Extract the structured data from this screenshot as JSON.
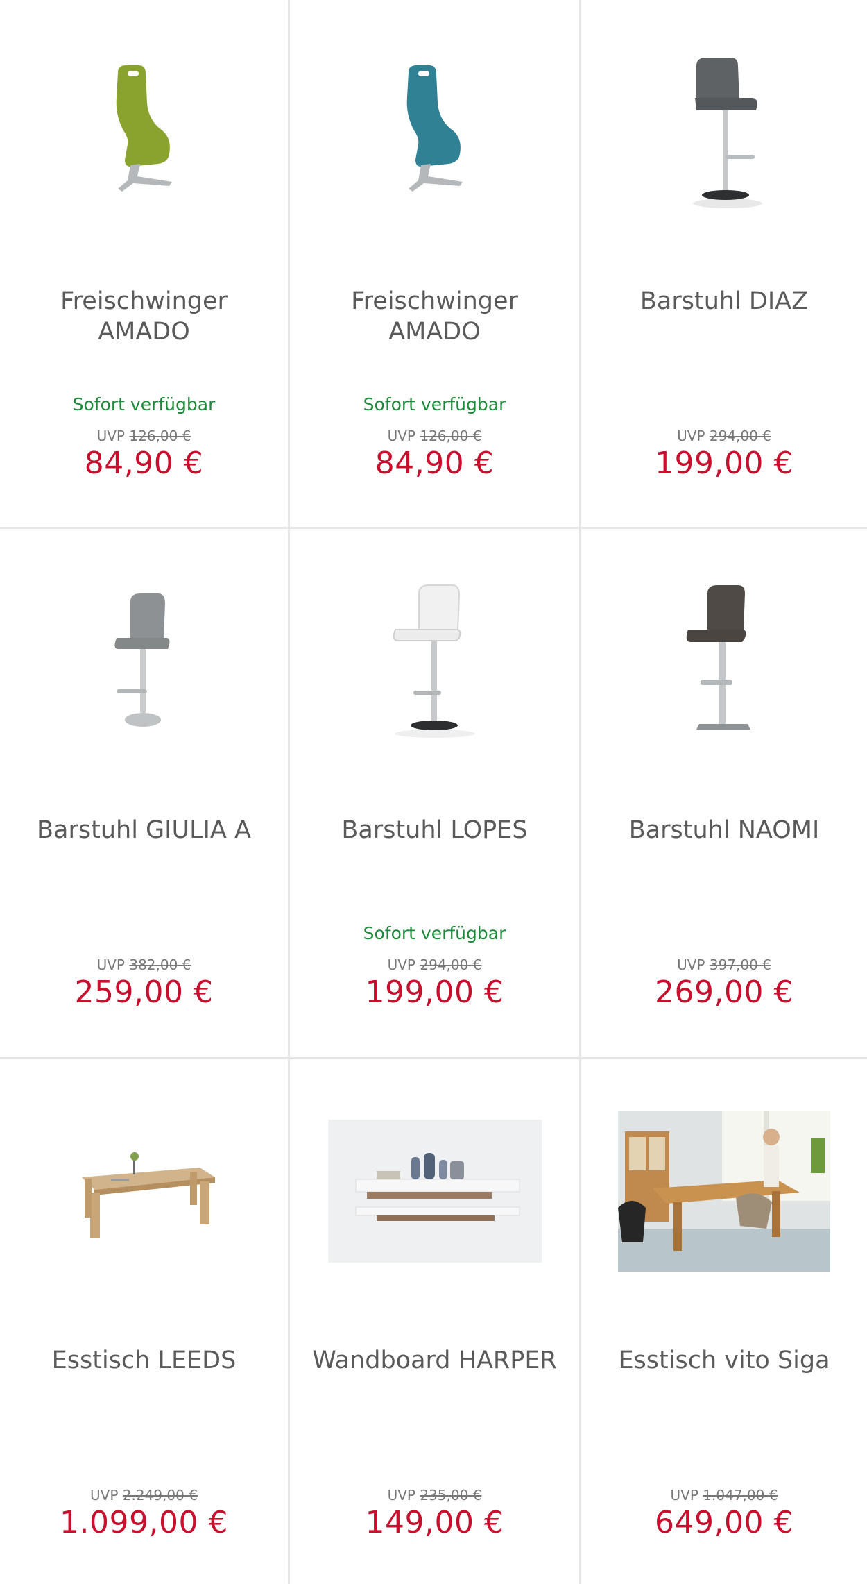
{
  "products": [
    {
      "title": "Freischwinger AMADO",
      "availability": "Sofort verfügbar",
      "uvp_label": "UVP",
      "uvp_price": "126,00 €",
      "price": "84,90 €",
      "image_icon": "cantilever-chair-green-icon"
    },
    {
      "title": "Freischwinger AMADO",
      "availability": "Sofort verfügbar",
      "uvp_label": "UVP",
      "uvp_price": "126,00 €",
      "price": "84,90 €",
      "image_icon": "cantilever-chair-petrol-icon"
    },
    {
      "title": "Barstuhl DIAZ",
      "availability": "",
      "uvp_label": "UVP",
      "uvp_price": "294,00 €",
      "price": "199,00 €",
      "image_icon": "bar-stool-grey-icon"
    },
    {
      "title": "Barstuhl GIULIA A",
      "availability": "",
      "uvp_label": "UVP",
      "uvp_price": "382,00 €",
      "price": "259,00 €",
      "image_icon": "bar-stool-lightgrey-icon"
    },
    {
      "title": "Barstuhl LOPES",
      "availability": "Sofort verfügbar",
      "uvp_label": "UVP",
      "uvp_price": "294,00 €",
      "price": "199,00 €",
      "image_icon": "bar-stool-white-icon"
    },
    {
      "title": "Barstuhl NAOMI",
      "availability": "",
      "uvp_label": "UVP",
      "uvp_price": "397,00 €",
      "price": "269,00 €",
      "image_icon": "bar-stool-brown-icon"
    },
    {
      "title": "Esstisch LEEDS",
      "availability": "",
      "uvp_label": "UVP",
      "uvp_price": "2.249,00 €",
      "price": "1.099,00 €",
      "image_icon": "dining-table-oak-icon"
    },
    {
      "title": "Wandboard HARPER",
      "availability": "",
      "uvp_label": "UVP",
      "uvp_price": "235,00 €",
      "price": "149,00 €",
      "image_icon": "wall-shelf-icon"
    },
    {
      "title": "Esstisch vito Siga",
      "availability": "",
      "uvp_label": "UVP",
      "uvp_price": "1.047,00 €",
      "price": "649,00 €",
      "image_icon": "dining-room-scene-icon"
    }
  ],
  "colors": {
    "price": "#c8102e",
    "availability": "#1d8a3a",
    "title": "#5a5a5a",
    "divider": "#e6e6e6"
  }
}
